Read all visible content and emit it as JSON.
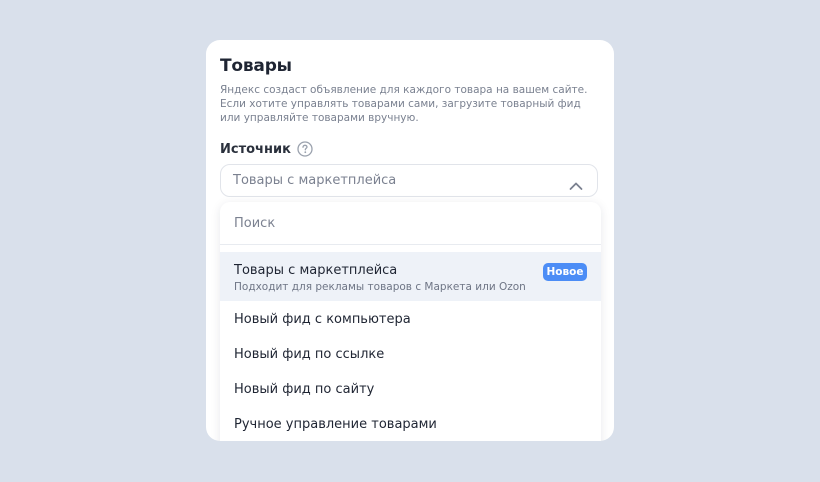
{
  "card": {
    "title": "Товары",
    "description": "Яндекс создаст объявление для каждого товара на вашем сайте. Если хотите управлять товарами сами, загрузите товарный фид или управляйте товарами вручную."
  },
  "source": {
    "label": "Источник",
    "help_icon": "question-circle-icon",
    "selected_value": "Товары с маркетплейса",
    "chevron_icon": "chevron-up-icon"
  },
  "dropdown": {
    "search_placeholder": "Поиск",
    "options": [
      {
        "label": "Товары с маркетплейса",
        "sublabel": "Подходит для рекламы товаров с Маркета или Ozon",
        "badge": "Новое",
        "selected": true
      },
      {
        "label": "Новый фид с компьютера"
      },
      {
        "label": "Новый фид по ссылке"
      },
      {
        "label": "Новый фид по сайту"
      },
      {
        "label": "Ручное управление товарами"
      }
    ]
  },
  "colors": {
    "page_background": "#d9e0eb",
    "badge": "#4c8df6",
    "selected_option_bg": "#eef2f8"
  }
}
